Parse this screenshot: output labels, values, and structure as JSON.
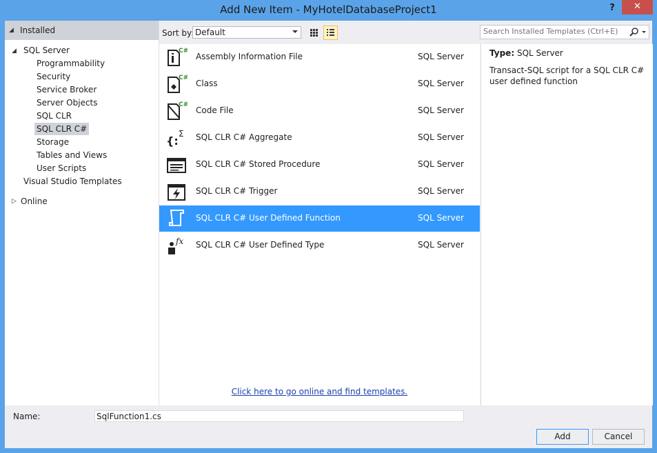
{
  "window": {
    "title": "Add New Item - MyHotelDatabaseProject1",
    "help": "?",
    "close": "✕"
  },
  "tree": {
    "installed": "Installed",
    "sql_server": "SQL Server",
    "children": [
      "Programmability",
      "Security",
      "Service Broker",
      "Server Objects",
      "SQL CLR",
      "SQL CLR C#",
      "Storage",
      "Tables and Views",
      "User Scripts"
    ],
    "selected": "SQL CLR C#",
    "vs_templates": "Visual Studio Templates",
    "online": "Online"
  },
  "toolbar": {
    "sort_label": "Sort by:",
    "sort_value": "Default"
  },
  "search": {
    "placeholder": "Search Installed Templates (Ctrl+E)"
  },
  "items": [
    {
      "name": "Assembly Information File",
      "category": "SQL Server",
      "icon": "assembly-info-icon"
    },
    {
      "name": "Class",
      "category": "SQL Server",
      "icon": "class-icon"
    },
    {
      "name": "Code File",
      "category": "SQL Server",
      "icon": "code-file-icon"
    },
    {
      "name": "SQL CLR C# Aggregate",
      "category": "SQL Server",
      "icon": "aggregate-icon"
    },
    {
      "name": "SQL CLR C# Stored Procedure",
      "category": "SQL Server",
      "icon": "stored-procedure-icon"
    },
    {
      "name": "SQL CLR C# Trigger",
      "category": "SQL Server",
      "icon": "trigger-icon"
    },
    {
      "name": "SQL CLR C# User Defined Function",
      "category": "SQL Server",
      "icon": "user-defined-function-icon",
      "selected": true
    },
    {
      "name": "SQL CLR C# User Defined Type",
      "category": "SQL Server",
      "icon": "user-defined-type-icon"
    }
  ],
  "online_link": "Click here to go online and find templates.",
  "details": {
    "type_label": "Type:",
    "type_value": "SQL Server",
    "description": "Transact-SQL script for a SQL CLR C# user defined function"
  },
  "name_field": {
    "label": "Name:",
    "value": "SqlFunction1.cs"
  },
  "buttons": {
    "add": "Add",
    "cancel": "Cancel"
  },
  "colors": {
    "title_bar": "#5aa3e8",
    "selection": "#3399ff",
    "close": "#c7504c",
    "link": "#1a3fae"
  }
}
